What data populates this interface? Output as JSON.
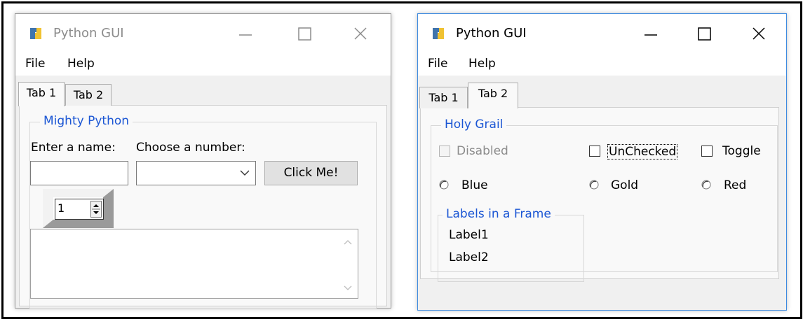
{
  "left_window": {
    "title": "Python GUI",
    "menu": [
      "File",
      "Help"
    ],
    "tabs": [
      {
        "label": "Tab 1",
        "active": true
      },
      {
        "label": "Tab 2",
        "active": false
      }
    ],
    "group_title": "Mighty Python",
    "name_label": "Enter a name:",
    "number_label": "Choose a number:",
    "name_value": "",
    "number_value": "",
    "button_label": "Click Me!",
    "spinbox_value": "1"
  },
  "right_window": {
    "title": "Python GUI",
    "menu": [
      "File",
      "Help"
    ],
    "tabs": [
      {
        "label": "Tab 1",
        "active": false
      },
      {
        "label": "Tab 2",
        "active": true
      }
    ],
    "group_title": "Holy Grail",
    "checkboxes": [
      {
        "label": "Disabled",
        "checked": false,
        "disabled": true
      },
      {
        "label": "UnChecked",
        "checked": false,
        "disabled": false
      },
      {
        "label": "Toggle",
        "checked": false,
        "disabled": false
      }
    ],
    "radios": [
      {
        "label": "Blue",
        "selected": false
      },
      {
        "label": "Gold",
        "selected": false
      },
      {
        "label": "Red",
        "selected": false
      }
    ],
    "labels_frame_title": "Labels in a Frame",
    "labels": [
      "Label1",
      "Label2"
    ]
  },
  "colors": {
    "group_title": "#1b56d4",
    "active_window_border": "#3c8ae0",
    "disabled_text": "#8c8c8c"
  }
}
